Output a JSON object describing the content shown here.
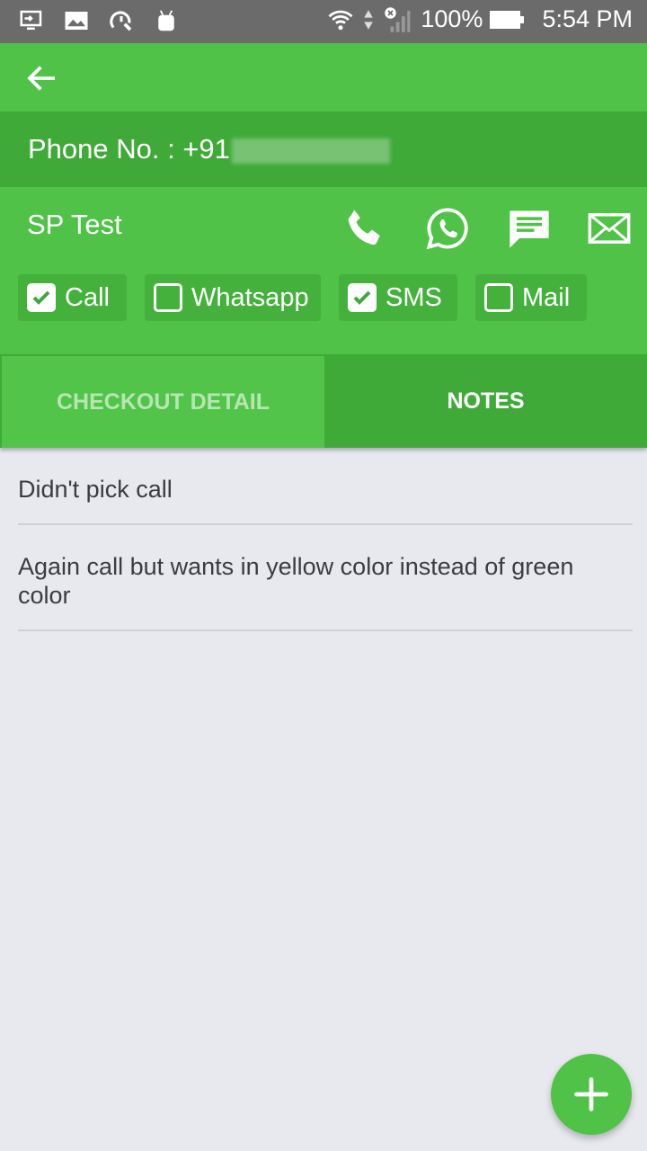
{
  "status_bar": {
    "left_icons": [
      "screen-cast-icon",
      "image-icon",
      "speed-tool-icon",
      "android-icon"
    ],
    "right_icons": [
      "wifi-icon",
      "data-arrows-icon",
      "signal-no-sim-icon",
      "battery-icon"
    ],
    "battery": "100%",
    "time": "5:54 PM"
  },
  "app_bar": {
    "back_icon": "arrow-left-icon"
  },
  "phone": {
    "label": "Phone No. : +91"
  },
  "contact": {
    "name": "SP Test",
    "actions": [
      "phone-icon",
      "whatsapp-icon",
      "message-icon",
      "mail-icon"
    ]
  },
  "channels": [
    {
      "label": "Call",
      "checked": true
    },
    {
      "label": "Whatsapp",
      "checked": false
    },
    {
      "label": "SMS",
      "checked": true
    },
    {
      "label": "Mail",
      "checked": false
    }
  ],
  "tabs": [
    {
      "label": "CHECKOUT DETAIL",
      "active": false
    },
    {
      "label": "NOTES",
      "active": true
    }
  ],
  "notes": [
    {
      "text": "Didn't pick call"
    },
    {
      "text": "Again call but wants in yellow color instead of green color"
    }
  ],
  "fab": {
    "icon": "plus-icon"
  },
  "colors": {
    "primary": "#4fc247",
    "primary_dark": "#3faa38",
    "background": "#e8e9ee"
  }
}
